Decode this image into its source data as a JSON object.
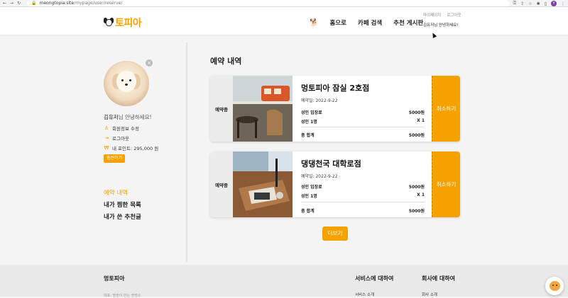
{
  "browser": {
    "url_host": "meongtopia.site",
    "url_path": "/mypage/user/reserve/",
    "profile_initial": "Y"
  },
  "header": {
    "logo_text": "토피아",
    "nav": [
      "홈으로",
      "카페 검색",
      "추천 게시판"
    ],
    "user_links": [
      "마이페이지",
      "로그아웃"
    ],
    "user_greeting": "김유저님 안녕하세요!"
  },
  "sidebar": {
    "user_name": "김유저",
    "greeting_suffix": "님 안녕하세요!",
    "edit_profile": "회원정보 수정",
    "logout": "로그아웃",
    "points_label": "내 포인트: 295,000 원",
    "charge_button": "충전하기",
    "nav": [
      {
        "label": "예약 내역",
        "active": true
      },
      {
        "label": "내가 찜한 목록",
        "active": false
      },
      {
        "label": "내가 쓴 추천글",
        "active": false
      }
    ]
  },
  "main": {
    "title": "예약 내역",
    "reservations": [
      {
        "status": "예약중",
        "store": "멍토피아 잠실 2호점",
        "date": "예약일: 2022-9-22",
        "adult_fee_label": "성인 입장료",
        "adult_fee": "5000원",
        "adult_count_label": "성인 1명",
        "adult_count": "X 1",
        "total_label": "총 합계",
        "total": "5000원",
        "cancel": "취소하기"
      },
      {
        "status": "예약중",
        "store": "댕댕천국 대학로점",
        "date": "예약일: 2022-9-22",
        "adult_fee_label": "성인 입장료",
        "adult_fee": "5000원",
        "adult_count_label": "성인 1명",
        "adult_count": "X 1",
        "total_label": "총 합계",
        "total": "5000원",
        "cancel": "취소하기"
      }
    ],
    "more_button": "더보기"
  },
  "footer": {
    "brand": "멍토피아",
    "fine_print": "대표: 멍멍이 만는 멍멍스",
    "col1_title": "서비스에 대하여",
    "col1_item": "서비스 소개",
    "col2_title": "회사에 대하여",
    "col2_item": "회사 소개"
  },
  "colors": {
    "accent": "#f5a200"
  }
}
